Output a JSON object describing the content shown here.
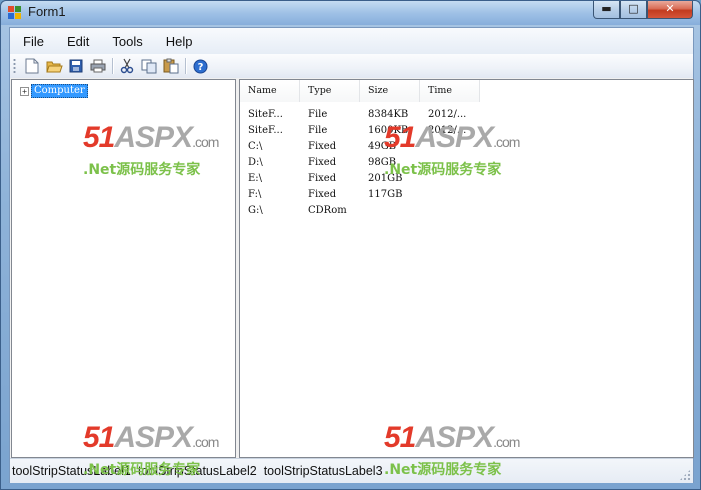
{
  "window": {
    "title": "Form1",
    "controls": {
      "minimize": "▬",
      "maximize": "□",
      "close": "✕"
    }
  },
  "menu": [
    "File",
    "Edit",
    "Tools",
    "Help"
  ],
  "toolbar": {
    "buttons": [
      "new-icon",
      "open-icon",
      "save-icon",
      "print-icon",
      "cut-icon",
      "copy-icon",
      "paste-icon",
      "help-icon"
    ]
  },
  "tree": {
    "root_label": "Computer",
    "expander": "+"
  },
  "list": {
    "columns": [
      "Name",
      "Type",
      "Size",
      "Time"
    ],
    "rows": [
      [
        "SiteF...",
        "File",
        "8384KB",
        "2012/..."
      ],
      [
        "SiteF...",
        "File",
        "1600KB",
        "2012/..."
      ],
      [
        "C:\\",
        "Fixed",
        "49GB",
        ""
      ],
      [
        "D:\\",
        "Fixed",
        "98GB",
        ""
      ],
      [
        "E:\\",
        "Fixed",
        "201GB",
        ""
      ],
      [
        "F:\\",
        "Fixed",
        "117GB",
        ""
      ],
      [
        "G:\\",
        "CDRom",
        "",
        ""
      ]
    ]
  },
  "status": [
    "toolStripStatusLabel1",
    "toolStripStatusLabel2",
    "toolStripStatusLabel3"
  ],
  "watermark": {
    "logo_num": "51",
    "logo_text": "ASPX",
    "logo_domain": ".com",
    "subtitle": ".Net源码服务专家"
  },
  "colors": {
    "selection": "#3399ff",
    "watermark_red": "#e33a2a",
    "watermark_green": "#7cc14a"
  }
}
